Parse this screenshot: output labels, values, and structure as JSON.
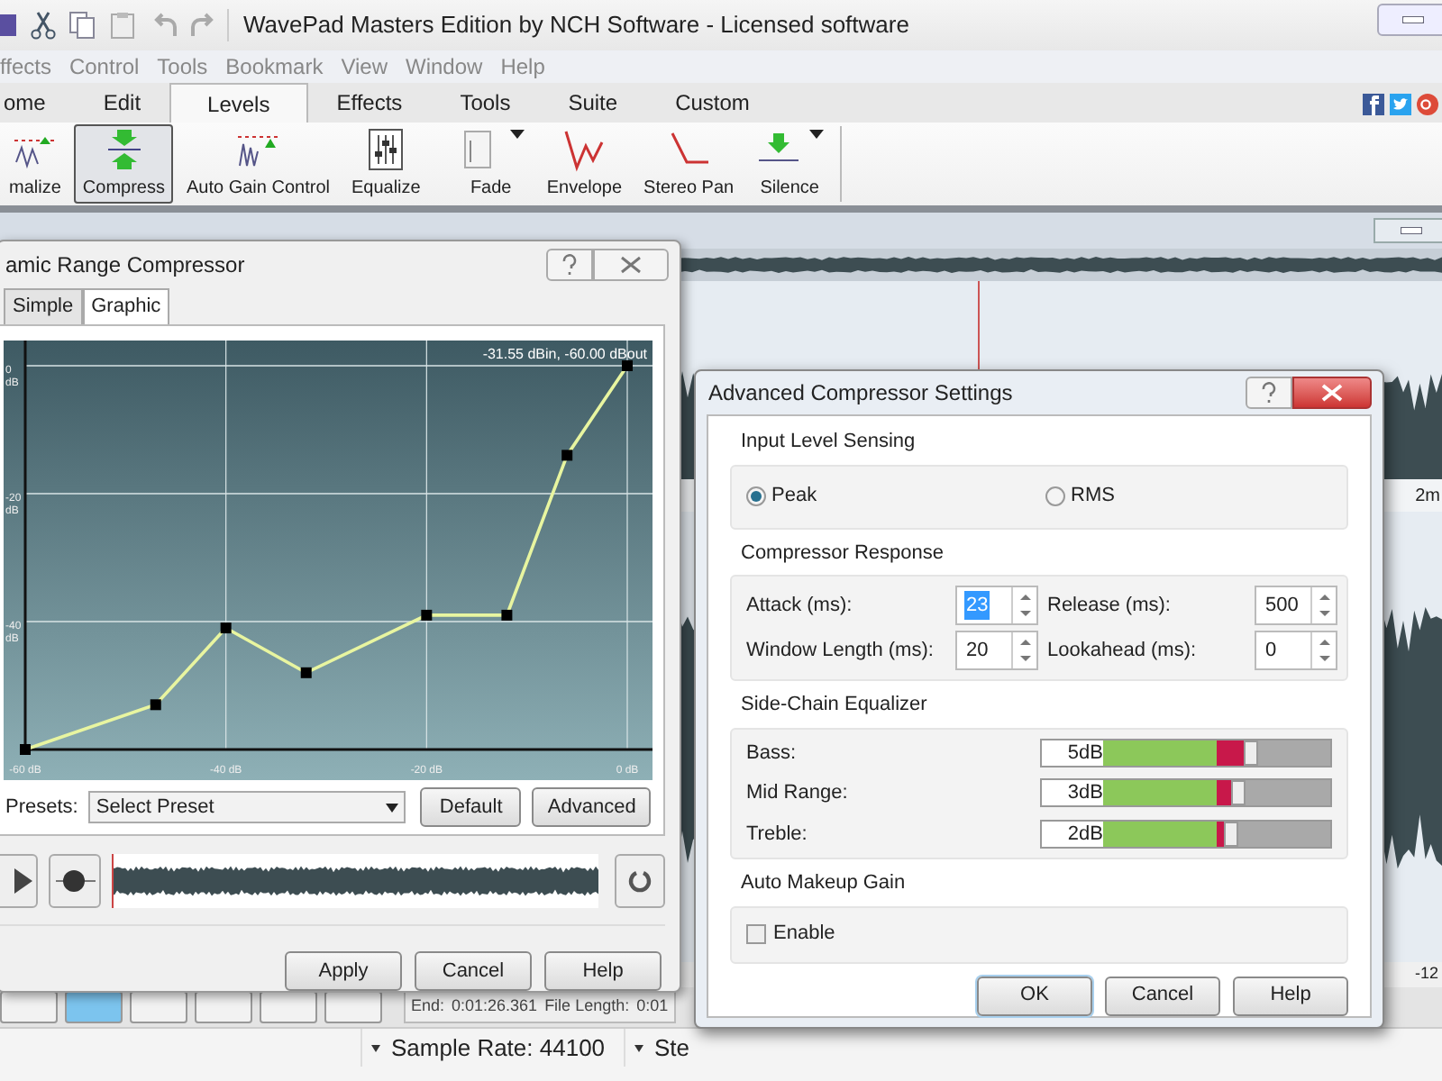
{
  "window": {
    "title": "WavePad Masters Edition by NCH Software - Licensed software"
  },
  "menu": [
    "ffects",
    "Control",
    "Tools",
    "Bookmark",
    "View",
    "Window",
    "Help"
  ],
  "tabs": [
    {
      "label": "ome",
      "selected": false
    },
    {
      "label": "Edit",
      "selected": false
    },
    {
      "label": "Levels",
      "selected": true
    },
    {
      "label": "Effects",
      "selected": false
    },
    {
      "label": "Tools",
      "selected": false
    },
    {
      "label": "Suite",
      "selected": false
    },
    {
      "label": "Custom",
      "selected": false
    }
  ],
  "ribbon": [
    {
      "label": "malize",
      "kind": "normalize",
      "selected": false,
      "dropdown": false
    },
    {
      "label": "Compress",
      "kind": "compress",
      "selected": true,
      "dropdown": false
    },
    {
      "label": "Auto Gain Control",
      "kind": "agc",
      "selected": false,
      "dropdown": false
    },
    {
      "label": "Equalize",
      "kind": "equalize",
      "selected": false,
      "dropdown": false
    },
    {
      "label": "Fade",
      "kind": "fade",
      "selected": false,
      "dropdown": true
    },
    {
      "label": "Envelope",
      "kind": "envelope",
      "selected": false,
      "dropdown": false
    },
    {
      "label": "Stereo Pan",
      "kind": "pan",
      "selected": false,
      "dropdown": false
    },
    {
      "label": "Silence",
      "kind": "silence",
      "selected": false,
      "dropdown": true
    }
  ],
  "timeline": {
    "ruler_label": "2m",
    "meter_label": "-12"
  },
  "selection_info": [
    {
      "label": "End:",
      "value": "0:01:26.361"
    },
    {
      "label": "File Length:",
      "value": "0:01"
    }
  ],
  "status_bar": [
    "Sample Rate: 44100",
    "Ste"
  ],
  "compressor": {
    "title": "amic Range Compressor",
    "tabs": [
      {
        "label": "Simple",
        "selected": false
      },
      {
        "label": "Graphic",
        "selected": true
      }
    ],
    "readout": "-31.55 dBin, -60.00 dBout",
    "chart_data": {
      "type": "line",
      "grid": true,
      "x": [
        -60,
        -47,
        -40,
        -32,
        -20,
        -12,
        -6,
        0
      ],
      "series": [
        {
          "color": "#e8f5a0",
          "marker": "square",
          "values": [
            -60,
            -53,
            -41,
            -48,
            -39,
            -39,
            -14,
            0
          ]
        }
      ],
      "xlim": [
        -60,
        0
      ],
      "ylim": [
        -60,
        0
      ],
      "xticks": [
        {
          "value": -60,
          "label": "-60 dB"
        },
        {
          "value": -40,
          "label": "-40 dB"
        },
        {
          "value": -20,
          "label": "-20 dB"
        },
        {
          "value": 0,
          "label": "0 dB"
        }
      ],
      "yticks": [
        {
          "value": 0,
          "label": "0 dB"
        },
        {
          "value": -20,
          "label": "-20 dB"
        },
        {
          "value": -40,
          "label": "-40 dB"
        }
      ]
    },
    "presets_label": "Presets:",
    "preset": "Select Preset",
    "buttons": [
      "Default",
      "Advanced"
    ],
    "footer_buttons": [
      "Apply",
      "Cancel",
      "Help"
    ]
  },
  "advanced": {
    "title": "Advanced Compressor Settings",
    "sensing": {
      "title": "Input Level Sensing",
      "options": [
        {
          "label": "Peak",
          "selected": true
        },
        {
          "label": "RMS",
          "selected": false
        }
      ]
    },
    "response": {
      "title": "Compressor Response",
      "fields": [
        {
          "label": "Attack (ms):",
          "value": "23"
        },
        {
          "label": "Release (ms):",
          "value": "500"
        },
        {
          "label": "Window Length (ms):",
          "value": "20"
        },
        {
          "label": "Lookahead (ms):",
          "value": "0"
        }
      ]
    },
    "equalizer": {
      "title": "Side-Chain Equalizer",
      "bands": [
        {
          "label": "Bass:",
          "reading": "5dB",
          "level": 0.62
        },
        {
          "label": "Mid Range:",
          "reading": "3dB",
          "level": 0.56
        },
        {
          "label": "Treble:",
          "reading": "2dB",
          "level": 0.53
        }
      ]
    },
    "makeup": {
      "title": "Auto Makeup Gain",
      "label": "Enable",
      "checked": false
    },
    "buttons": [
      "OK",
      "Cancel",
      "Help"
    ]
  }
}
